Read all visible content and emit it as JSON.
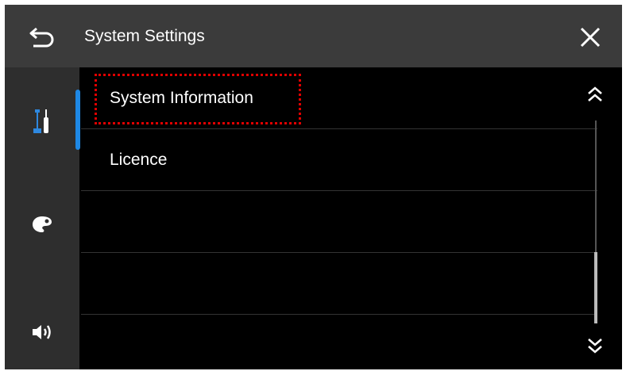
{
  "header": {
    "title": "System Settings",
    "back_icon": "back-arrow-icon",
    "close_icon": "close-icon"
  },
  "sidebar": {
    "tabs": [
      {
        "icon": "tools-icon",
        "active": true
      },
      {
        "icon": "palette-icon",
        "active": false
      },
      {
        "icon": "speaker-icon",
        "active": false
      }
    ]
  },
  "list": {
    "items": [
      {
        "label": "System Information",
        "highlighted": true
      },
      {
        "label": "Licence",
        "highlighted": false
      },
      {
        "label": ""
      },
      {
        "label": ""
      },
      {
        "label": ""
      }
    ]
  },
  "scrollbar": {
    "up_icon": "double-chevron-up-icon",
    "down_icon": "double-chevron-down-icon"
  },
  "colors": {
    "header_bg": "#3b3b3b",
    "sidebar_bg": "#2e2e2e",
    "content_bg": "#000000",
    "accent": "#1e88e5",
    "highlight": "#e00000"
  }
}
